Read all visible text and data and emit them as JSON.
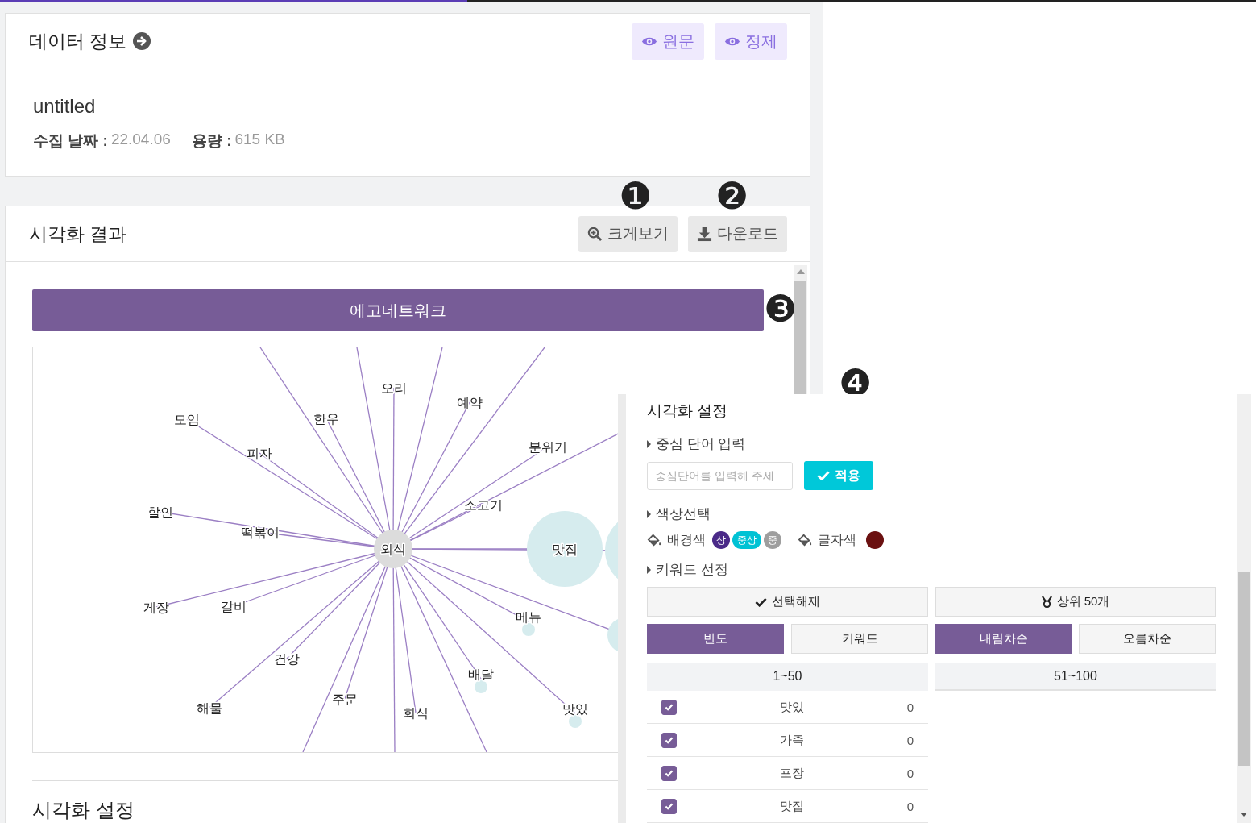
{
  "info_card": {
    "title": "데이터 정보",
    "buttons": [
      "원문",
      "정제"
    ]
  },
  "dataset": {
    "name": "untitled",
    "fields": [
      {
        "label": "수집 날짜 :",
        "value": "22.04.06"
      },
      {
        "label": "용량 :",
        "value": "615 KB"
      }
    ]
  },
  "viz_card": {
    "title": "시각화 결과",
    "buttons": [
      {
        "label": "크게보기",
        "kind": "zoom"
      },
      {
        "label": "다운로드",
        "kind": "download"
      }
    ],
    "banner": "에고네트워크",
    "section_title": "시각화 설정"
  },
  "graph": {
    "nodes": [
      {
        "label": "외식",
        "kind": "center"
      },
      {
        "label": "모임",
        "kind": "leaf"
      },
      {
        "label": "한우",
        "kind": "leaf"
      },
      {
        "label": "오리",
        "kind": "leaf"
      },
      {
        "label": "예약",
        "kind": "leaf"
      },
      {
        "label": "분위기",
        "kind": "leaf"
      },
      {
        "label": "피자",
        "kind": "leaf"
      },
      {
        "label": "할인",
        "kind": "leaf"
      },
      {
        "label": "떡볶이",
        "kind": "leaf"
      },
      {
        "label": "소고기",
        "kind": "leaf"
      },
      {
        "label": "맛집",
        "kind": "hub"
      },
      {
        "label": "게장",
        "kind": "leaf"
      },
      {
        "label": "갈비",
        "kind": "leaf"
      },
      {
        "label": "메뉴",
        "kind": "dot"
      },
      {
        "label": "건강",
        "kind": "leaf"
      },
      {
        "label": "배달",
        "kind": "dot"
      },
      {
        "label": "해물",
        "kind": "leaf"
      },
      {
        "label": "주문",
        "kind": "leaf"
      },
      {
        "label": "회식",
        "kind": "leaf"
      },
      {
        "label": "맛있",
        "kind": "dot"
      }
    ]
  },
  "callouts": [
    "❶",
    "❷",
    "❸",
    "❹"
  ],
  "settings": {
    "title": "시각화 설정",
    "center_word": {
      "heading": "중심 단어 입력",
      "placeholder": "중심단어를 입력해 주세",
      "apply": "적용"
    },
    "colors": {
      "heading": "색상선택",
      "background_label": "배경색",
      "levels": [
        {
          "label": "상",
          "color": "#4b2a88"
        },
        {
          "label": "중상",
          "color": "#00c2d4"
        },
        {
          "label": "중",
          "color": "#9e9e9e"
        }
      ],
      "text_label": "글자색",
      "swatch": {
        "color": "#6b1111"
      }
    },
    "keywords": {
      "heading": "키워드 선정",
      "actions": [
        {
          "label": "선택해제",
          "kind": "clear"
        },
        {
          "label": "상위 50개",
          "kind": "top"
        }
      ],
      "sort": [
        {
          "label": "빈도",
          "selected": true
        },
        {
          "label": "키워드",
          "selected": false
        }
      ],
      "order": [
        {
          "label": "내림차순",
          "selected": true
        },
        {
          "label": "오름차순",
          "selected": false
        }
      ],
      "ranges": [
        {
          "label": "1~50",
          "selected": true
        },
        {
          "label": "51~100",
          "selected": false
        }
      ],
      "rows": [
        {
          "word": "맛있",
          "count": "0",
          "checked": true
        },
        {
          "word": "가족",
          "count": "0",
          "checked": true
        },
        {
          "word": "포장",
          "count": "0",
          "checked": true
        },
        {
          "word": "맛집",
          "count": "0",
          "checked": true
        }
      ]
    }
  }
}
